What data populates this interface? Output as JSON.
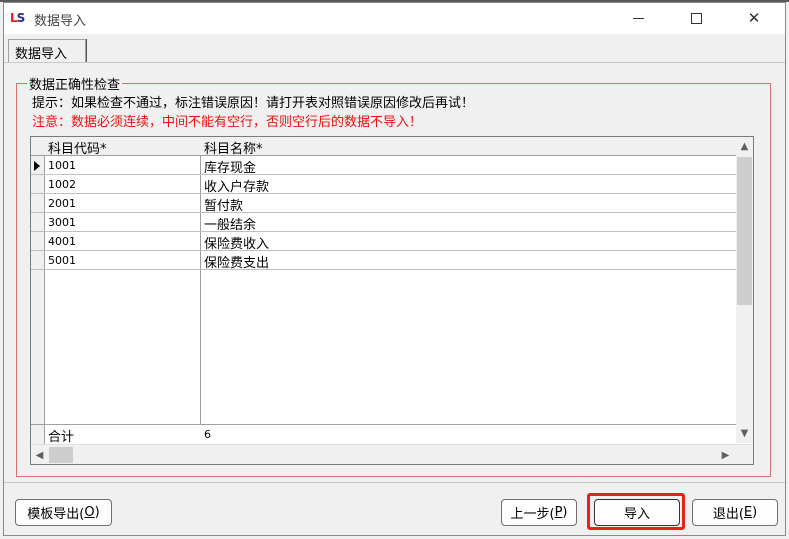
{
  "window": {
    "title": "数据导入",
    "icon": "app-logo-icon"
  },
  "titlebar_buttons": [
    "minimize-icon",
    "maximize-icon",
    "close-icon"
  ],
  "tab": {
    "label": "数据导入"
  },
  "group": {
    "legend": "数据正确性检查",
    "hint": "提示：如果检查不通过，标注错误原因！请打开表对照错误原因修改后再试！",
    "warning": "注意：数据必须连续，中间不能有空行，否则空行后的数据不导入！",
    "warning_color": "#ee1111"
  },
  "grid": {
    "columns": [
      "科目代码*",
      "科目名称*"
    ],
    "rows": [
      {
        "code": "1001",
        "name": "库存现金"
      },
      {
        "code": "1002",
        "name": "收入户存款"
      },
      {
        "code": "2001",
        "name": "暂付款"
      },
      {
        "code": "3001",
        "name": "一般结余"
      },
      {
        "code": "4001",
        "name": "保险费收入"
      },
      {
        "code": "5001",
        "name": "保险费支出"
      }
    ],
    "total_label": "合计",
    "total_value": "6"
  },
  "footer": {
    "template_export": {
      "text": "模板导出(",
      "key": "O",
      "end": ")"
    },
    "prev": {
      "text": "上一步(",
      "key": "P",
      "end": ")"
    },
    "import": {
      "text": "导入"
    },
    "exit": {
      "text": "退出(",
      "key": "E",
      "end": ")"
    },
    "highlight_color": "#e8201a"
  }
}
